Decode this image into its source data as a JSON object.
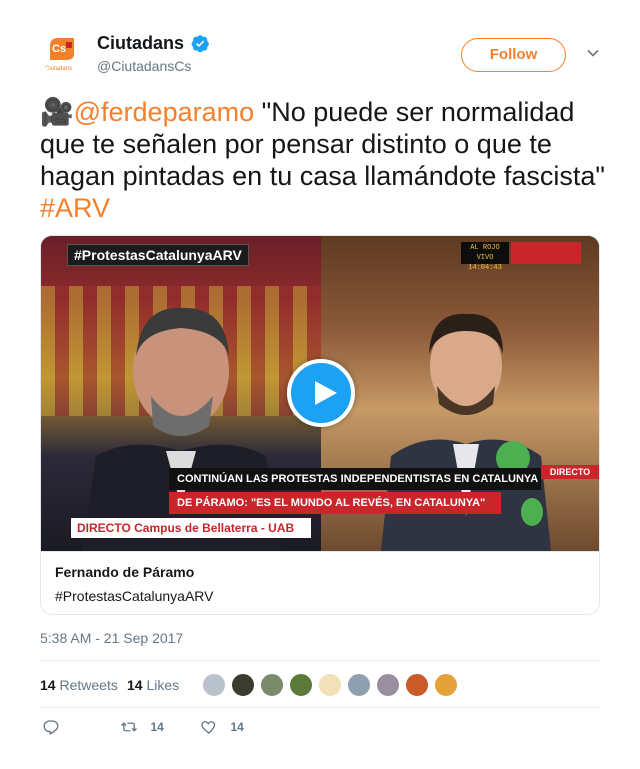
{
  "author": {
    "display_name": "Ciutadans",
    "handle": "@CiutadansCs",
    "avatar_logo_text": "Cs",
    "avatar_sub_text": "Ciutadans",
    "verified": true
  },
  "follow_button": {
    "label": "Follow"
  },
  "tweet": {
    "emoji": "🎥",
    "mention": "@ferdeparamo",
    "text": " \"No puede ser normalidad que te señalen por pensar distinto o que te hagan pintadas en tu casa llamándote fascista\" ",
    "hashtag": "#ARV"
  },
  "media_card": {
    "video_overlay": {
      "hashtag_bar": "#ProtestasCatalunyaARV",
      "lower_third_1": "CONTINÚAN LAS PROTESTAS INDEPENDENTISTAS EN CATALUNYA",
      "lower_third_2": "DE PÁRAMO: \"ES EL MUNDO AL REVÉS, EN CATALUNYA\"",
      "lower_third_3": "DIRECTO Campus de Bellaterra - UAB",
      "live_tag": "DIRECTO",
      "clock_label": "AL ROJO VIVO",
      "clock_time": "14:04:43"
    },
    "title": "Fernando de Páramo",
    "description": "#ProtestasCatalunyaARV"
  },
  "timestamp": "5:38 AM - 21 Sep 2017",
  "stats": {
    "retweets_count": "14",
    "retweets_label": "Retweets",
    "likes_count": "14",
    "likes_label": "Likes"
  },
  "actions": {
    "reply_count": "",
    "retweet_count": "14",
    "like_count": "14"
  },
  "colors": {
    "accent": "#f4802b",
    "text": "#14171a",
    "muted": "#657786",
    "play": "#1da1f2"
  }
}
